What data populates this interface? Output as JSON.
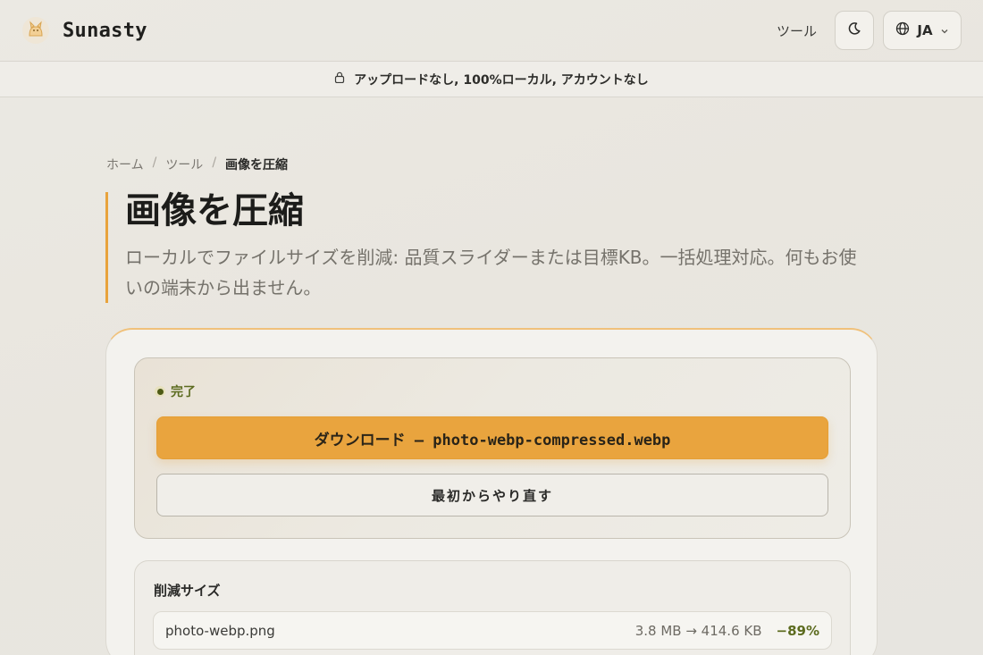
{
  "header": {
    "brand": "Sunasty",
    "nav_tools": "ツール",
    "lang_code": "JA"
  },
  "banner": {
    "text": "アップロードなし, 100%ローカル, アカウントなし"
  },
  "breadcrumb": {
    "home": "ホーム",
    "tools": "ツール",
    "current": "画像を圧縮",
    "separator": "/"
  },
  "page": {
    "title": "画像を圧縮",
    "description": "ローカルでファイルサイズを削減: 品質スライダーまたは目標KB。一括処理対応。何もお使いの端末から出ません。"
  },
  "result": {
    "status": "完了",
    "download_label": "ダウンロード — photo-webp-compressed.webp",
    "restart_label": "最初からやり直す"
  },
  "savings": {
    "title": "削減サイズ",
    "files": [
      {
        "name": "photo-webp.png",
        "sizes": "3.8 MB → 414.6 KB",
        "percent": "−89%"
      }
    ]
  },
  "colors": {
    "accent": "#e9a43e",
    "success": "#5c6b1f"
  },
  "icons": {
    "logo": "cat-logo-icon",
    "theme": "moon-icon",
    "language": "globe-icon",
    "dropdown": "chevron-down-icon",
    "banner": "lock-icon"
  }
}
